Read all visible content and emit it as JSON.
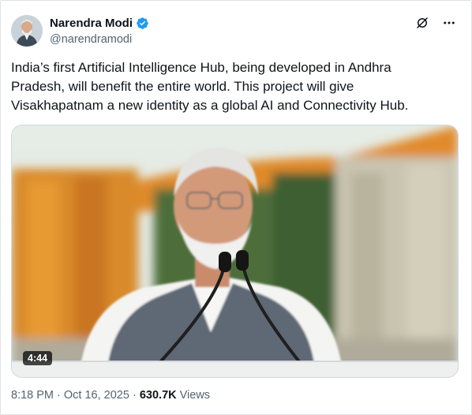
{
  "author": {
    "name": "Narendra Modi",
    "handle": "@narendramodi",
    "verified": true,
    "verified_color": "#1d9bf0"
  },
  "tweet": {
    "text": "India’s first Artificial Intelligence Hub, being developed in Andhra\nPradesh, will benefit the entire world. This project will give\nVisakhapatnam a new identity as a global AI and Connectivity Hub."
  },
  "media": {
    "type": "video",
    "duration": "4:44",
    "progress": 0.0
  },
  "meta": {
    "time": "8:18 PM",
    "separator": "·",
    "date": "Oct 16, 2025",
    "views_count": "630.7K",
    "views_label": "Views"
  },
  "icons": [
    "grok-icon",
    "more-icon",
    "verified-badge-icon"
  ]
}
